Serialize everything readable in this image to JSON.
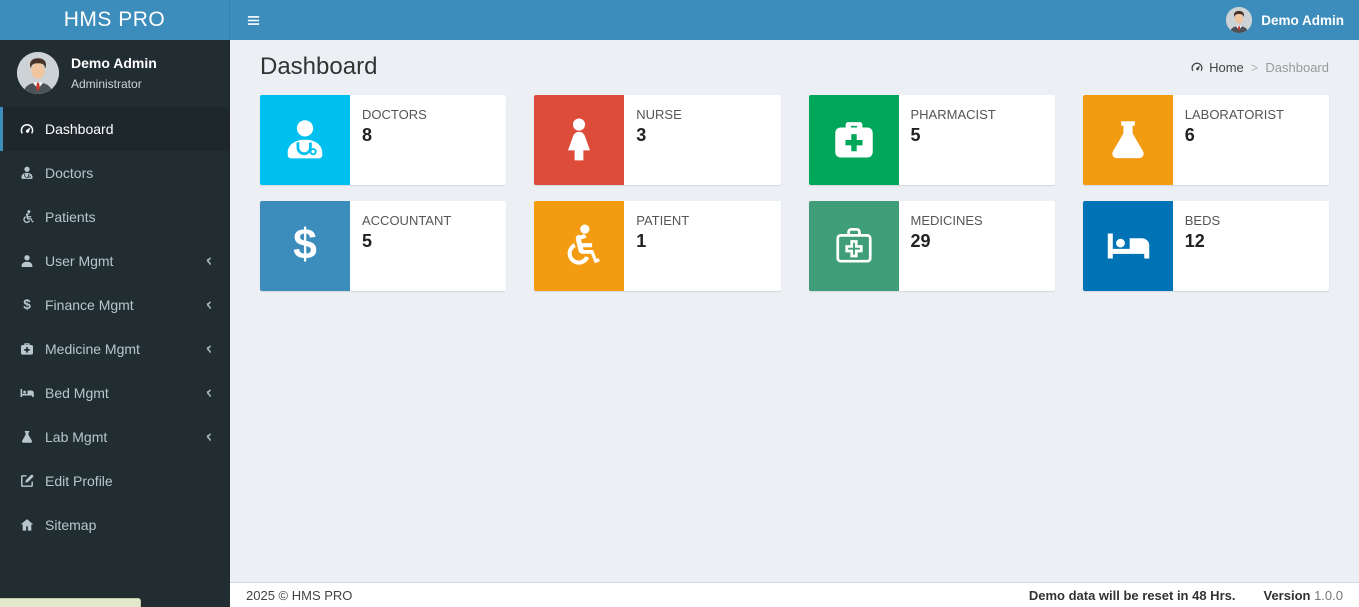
{
  "brand": {
    "title": "HMS PRO"
  },
  "header": {
    "user_name": "Demo Admin",
    "avatar": "male-avatar"
  },
  "sidebar": {
    "profile": {
      "name": "Demo Admin",
      "role": "Administrator",
      "avatar": "male-avatar"
    },
    "items": [
      {
        "label": "Dashboard",
        "icon": "dashboard",
        "active": true,
        "has_submenu": false
      },
      {
        "label": "Doctors",
        "icon": "doctor",
        "active": false,
        "has_submenu": false
      },
      {
        "label": "Patients",
        "icon": "wheelchair",
        "active": false,
        "has_submenu": false
      },
      {
        "label": "User Mgmt",
        "icon": "user",
        "active": false,
        "has_submenu": true
      },
      {
        "label": "Finance Mgmt",
        "icon": "dollar",
        "active": false,
        "has_submenu": true
      },
      {
        "label": "Medicine Mgmt",
        "icon": "medkit",
        "active": false,
        "has_submenu": true
      },
      {
        "label": "Bed Mgmt",
        "icon": "bed",
        "active": false,
        "has_submenu": true
      },
      {
        "label": "Lab Mgmt",
        "icon": "flask",
        "active": false,
        "has_submenu": true
      },
      {
        "label": "Edit Profile",
        "icon": "edit",
        "active": false,
        "has_submenu": false
      },
      {
        "label": "Sitemap",
        "icon": "home",
        "active": false,
        "has_submenu": false
      }
    ]
  },
  "main": {
    "page_title": "Dashboard",
    "breadcrumb": {
      "icon": "dashboard",
      "home": "Home",
      "separator": ">",
      "current": "Dashboard"
    },
    "cards": [
      {
        "label": "DOCTORS",
        "value": "8",
        "icon": "doctor",
        "color": "#00c0ef"
      },
      {
        "label": "NURSE",
        "value": "3",
        "icon": "female",
        "color": "#dd4b39"
      },
      {
        "label": "PHARMACIST",
        "value": "5",
        "icon": "medkit",
        "color": "#00a65a"
      },
      {
        "label": "LABORATORIST",
        "value": "6",
        "icon": "flask",
        "color": "#f39c12"
      },
      {
        "label": "ACCOUNTANT",
        "value": "5",
        "icon": "dollar",
        "color": "#3c8dbc"
      },
      {
        "label": "PATIENT",
        "value": "1",
        "icon": "wheelchair",
        "color": "#f39c12"
      },
      {
        "label": "MEDICINES",
        "value": "29",
        "icon": "medkit-outline",
        "color": "#3f9e77"
      },
      {
        "label": "BEDS",
        "value": "12",
        "icon": "bed",
        "color": "#0073b7"
      }
    ]
  },
  "footer": {
    "copyright": "2025 © HMS PRO",
    "notice": "Demo data will be reset in 48 Hrs.",
    "version_label": "Version",
    "version_value": "1.0.0"
  },
  "colors": {
    "header_bg": "#3c8dbc",
    "sidebar_bg": "#222d32",
    "sidebar_active_bg": "#1e282c",
    "content_bg": "#ecf0f5"
  }
}
